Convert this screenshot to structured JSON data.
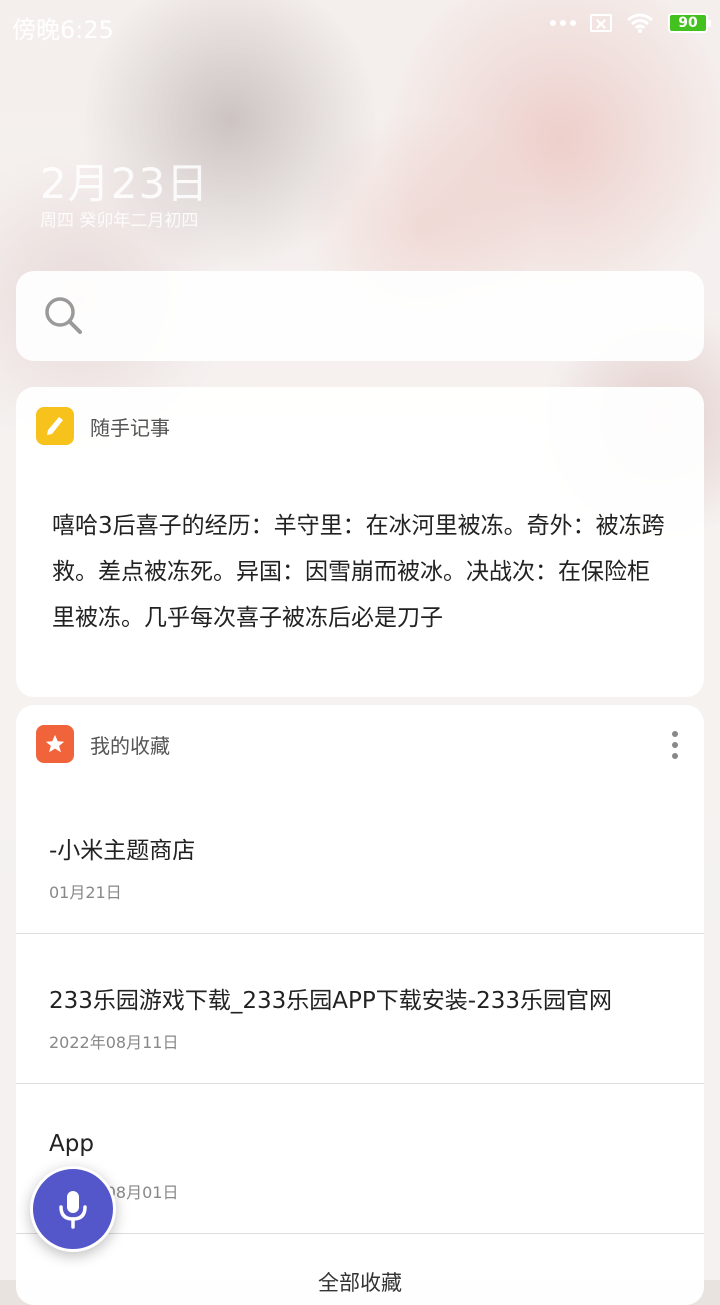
{
  "status_bar": {
    "time": "傍晚6:25",
    "battery": "90"
  },
  "date": {
    "main": "2月23日",
    "sub": "周四 癸卯年二月初四"
  },
  "search": {
    "placeholder": ""
  },
  "note_card": {
    "title": "随手记事",
    "content": "嘻哈3后喜子的经历：羊守里：在冰河里被冻。奇外：被冻跨救。差点被冻死。异国：因雪崩而被冰。决战次：在保险柜里被冻。几乎每次喜子被冻后必是刀子"
  },
  "favorites_card": {
    "title": "我的收藏",
    "items": [
      {
        "title": "-小米主题商店",
        "date": "01月21日"
      },
      {
        "title": "233乐园游戏下载_233乐园APP下载安装-233乐园官网",
        "date": "2022年08月11日"
      },
      {
        "title": "App",
        "date": "2022年08月01日"
      }
    ],
    "view_all": "全部收藏"
  },
  "colors": {
    "note_icon": "#f7c21b",
    "fav_icon": "#f1633a",
    "voice_button": "#5457c9",
    "battery": "#43c11e"
  },
  "icons": [
    "search-icon",
    "pencil-icon",
    "star-icon",
    "more-icon",
    "microphone-icon",
    "wifi-icon",
    "battery-icon"
  ]
}
